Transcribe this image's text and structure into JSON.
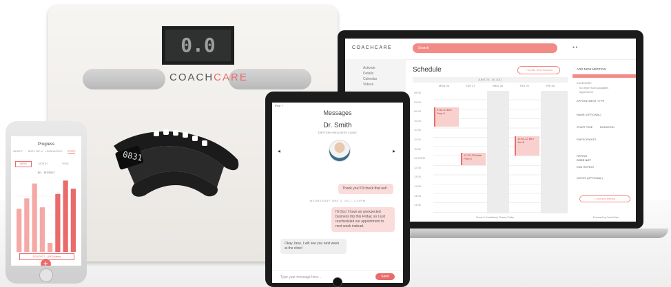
{
  "scale": {
    "display": "0.0",
    "brand_a": "COACH",
    "brand_b": "CARE"
  },
  "band": {
    "time": "0831"
  },
  "laptop": {
    "logo": "COACHCARE",
    "search": "Search",
    "title": "Schedule",
    "new_button": "+ Create New Session",
    "nav_date": "JUNE 26 - 30, 2017",
    "days": [
      "MON 26",
      "TUE 27",
      "WED 28",
      "THU 29",
      "FRI 30"
    ],
    "times": [
      "08:30",
      "09:00",
      "09:30",
      "10:00",
      "10:30",
      "11:00",
      "11:30",
      "12:00PM",
      "12:30",
      "13:00",
      "13:30",
      "14:00",
      "14:30"
    ],
    "sidebar": [
      "Activate",
      "Details",
      "Calendar",
      "Videos"
    ],
    "events": [
      {
        "text": "9:30-10 Ben Prep K"
      },
      {
        "text": "12:30-13 Katie Prep K"
      },
      {
        "text": "11:30-12 Ben Jon B"
      }
    ],
    "panel": {
      "header": "ADD NEW MEETING",
      "category": "CATEGORY",
      "opt1": "No Office Hours (Available)",
      "opt2": "Appointment",
      "type_label": "APPOINTMENT TYPE",
      "name_label": "NAME (OPTIONAL)",
      "start": "START TIME",
      "duration": "DURATION",
      "participants": "PARTICIPANTS",
      "repeat": "REPEAT",
      "repeat_val": "DOES NOT",
      "end_repeat": "END REPEAT",
      "notes": "NOTES (OPTIONAL)",
      "add": "+ Add New Meeting"
    },
    "footer_left": "Terms & Conditions | Privacy Policy",
    "footer_right": "Powered by CoachCare"
  },
  "tablet": {
    "title": "Messages",
    "contact": "Dr. Smith",
    "subtitle": "DIETITIAN WELLNESS CLINIC",
    "msg1": "Thank you! I'll check that out!",
    "date": "WEDNESDAY, MAY 3, 2017, 2:00PM",
    "msg2": "Hi Doc! I have an unexpected business trip this Friday, so I just rescheduled our appointment to next week instead.",
    "msg3": "Okay Jane, I will see you next week at the clinic!",
    "input_placeholder": "Type your message here...",
    "send": "Send",
    "status": "iPad ⌔"
  },
  "phone": {
    "title": "Progress",
    "tabs": [
      "WEIGHT",
      "BODY FAT %",
      "LEAN MUSCLE",
      "STEPS"
    ],
    "segments": [
      "WEEK",
      "MONTH",
      "YEAR"
    ],
    "range": "5/1 - 5/7/2017",
    "total": "5/31/2017 - 6000 steps",
    "nav": [
      "Home",
      "Schedule",
      "",
      "Messages",
      "Account"
    ],
    "plus": "+"
  },
  "chart_data": {
    "type": "bar",
    "categories": [
      "1",
      "2",
      "3",
      "4",
      "5",
      "6",
      "7",
      "8"
    ],
    "values": [
      58,
      72,
      92,
      60,
      12,
      78,
      96,
      85
    ],
    "title": "",
    "xlabel": "",
    "ylabel": "",
    "ylim": [
      0,
      100
    ]
  },
  "colors": {
    "accent": "#e96b6b",
    "accent_light": "#f8d0cd"
  }
}
